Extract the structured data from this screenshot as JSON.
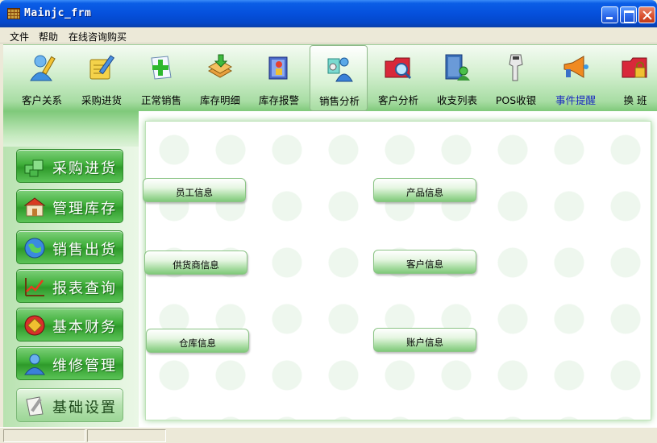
{
  "window": {
    "title": "Mainjc_frm"
  },
  "menu": [
    "文件",
    "帮助",
    "在线咨询购买"
  ],
  "toolbar": [
    {
      "label": "客户关系",
      "icon": "pen-person-icon"
    },
    {
      "label": "采购进货",
      "icon": "notepad-pencil-icon"
    },
    {
      "label": "正常销售",
      "icon": "add-document-icon"
    },
    {
      "label": "库存明细",
      "icon": "stack-arrow-icon"
    },
    {
      "label": "库存报警",
      "icon": "alarm-book-icon"
    },
    {
      "label": "销售分析",
      "icon": "people-chart-icon"
    },
    {
      "label": "客户分析",
      "icon": "folder-magnifier-icon"
    },
    {
      "label": "收支列表",
      "icon": "book-person-icon"
    },
    {
      "label": "POS收银",
      "icon": "barcode-scanner-icon"
    },
    {
      "label": "事件提醒",
      "icon": "megaphone-icon"
    },
    {
      "label": "换  班",
      "icon": "folder-lock-icon"
    }
  ],
  "sidebar": [
    {
      "label": "采购进货",
      "icon": "boxes-icon"
    },
    {
      "label": "管理库存",
      "icon": "store-icon"
    },
    {
      "label": "销售出货",
      "icon": "globe-icon"
    },
    {
      "label": "报表查询",
      "icon": "line-chart-icon"
    },
    {
      "label": "基本财务",
      "icon": "finance-icon"
    },
    {
      "label": "维修管理",
      "icon": "user-icon"
    },
    {
      "label": "基础设置",
      "icon": "settings-doc-icon"
    }
  ],
  "content_buttons": {
    "employee": "员工信息",
    "product": "产品信息",
    "supplier": "供货商信息",
    "customer": "客户信息",
    "warehouse": "仓库信息",
    "account": "账户信息"
  },
  "colors": {
    "accent": "#3FAF3A",
    "titlebar": "#0550DC",
    "toolbar": "#A8DDA4"
  }
}
